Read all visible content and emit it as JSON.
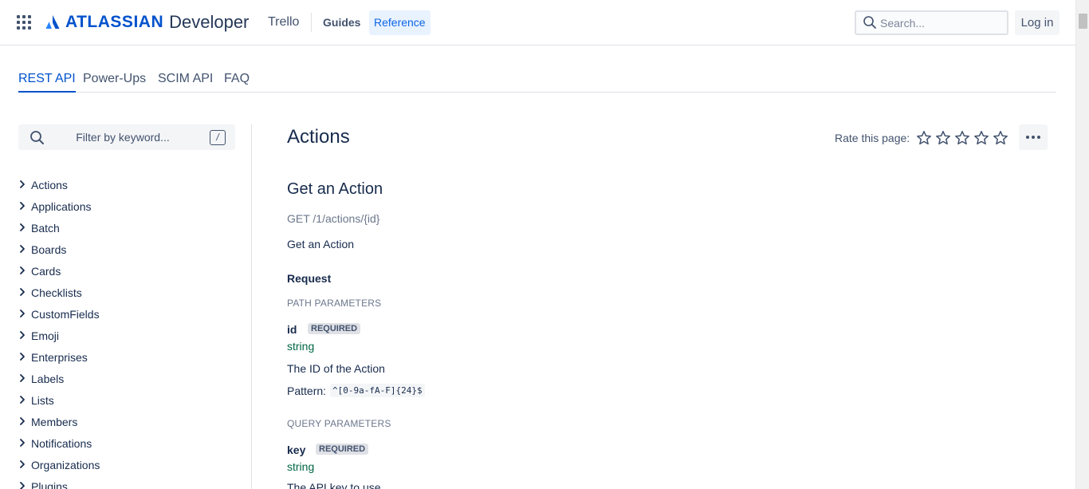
{
  "header": {
    "brand": "ATLASSIAN",
    "product": "Developer",
    "nav_product": "Trello",
    "nav_links": [
      {
        "label": "Guides",
        "active": false
      },
      {
        "label": "Reference",
        "active": true
      }
    ],
    "search_placeholder": "Search...",
    "login_label": "Log in"
  },
  "tabs": [
    {
      "label": "REST API",
      "active": true
    },
    {
      "label": "Power-Ups",
      "active": false
    },
    {
      "label": "SCIM API",
      "active": false
    },
    {
      "label": "FAQ",
      "active": false
    }
  ],
  "sidebar": {
    "filter_placeholder": "Filter by keyword...",
    "filter_shortcut": "/",
    "items": [
      {
        "label": "Actions"
      },
      {
        "label": "Applications"
      },
      {
        "label": "Batch"
      },
      {
        "label": "Boards"
      },
      {
        "label": "Cards"
      },
      {
        "label": "Checklists"
      },
      {
        "label": "CustomFields"
      },
      {
        "label": "Emoji"
      },
      {
        "label": "Enterprises"
      },
      {
        "label": "Labels"
      },
      {
        "label": "Lists"
      },
      {
        "label": "Members"
      },
      {
        "label": "Notifications"
      },
      {
        "label": "Organizations"
      },
      {
        "label": "Plugins"
      }
    ]
  },
  "main": {
    "title": "Actions",
    "rate_label": "Rate this page:",
    "rating_max": 5,
    "rating_value": 0,
    "operation": {
      "title": "Get an Action",
      "method_path": "GET /1/actions/{id}",
      "description": "Get an Action",
      "request_label": "Request",
      "path_params_label": "PATH PARAMETERS",
      "path_params": [
        {
          "name": "id",
          "badge": "REQUIRED",
          "type": "string",
          "description": "The ID of the Action",
          "pattern_label": "Pattern:",
          "pattern": "^[0-9a-fA-F]{24}$"
        }
      ],
      "query_params_label": "QUERY PARAMETERS",
      "query_params": [
        {
          "name": "key",
          "badge": "REQUIRED",
          "type": "string",
          "description": "The API key to use"
        }
      ]
    }
  },
  "colors": {
    "brand_blue": "#0052cc",
    "text": "#172b4d",
    "subtle_text": "#6b778c",
    "type_green": "#006644",
    "reference_bg": "#e9f2ff"
  }
}
